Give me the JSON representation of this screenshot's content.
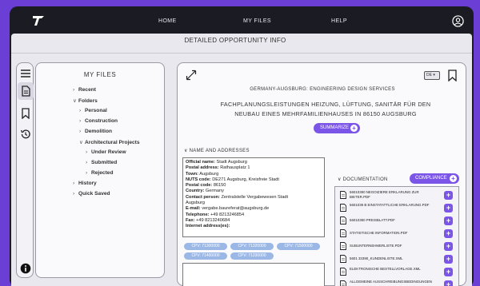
{
  "nav": {
    "home": "HOME",
    "my_files": "MY FILES",
    "help": "HELP"
  },
  "page_title": "DETAILED OPPORTUNITY INFO",
  "files_panel": {
    "title": "MY FILES",
    "items": [
      {
        "label": "Recent",
        "caret": "›"
      },
      {
        "label": "Folders",
        "caret": "∨"
      },
      {
        "label": "Personal",
        "caret": "›"
      },
      {
        "label": "Construction",
        "caret": "›"
      },
      {
        "label": "Demolition",
        "caret": "›"
      },
      {
        "label": "Architectural Projects",
        "caret": "∨"
      },
      {
        "label": "Under Review",
        "caret": "›"
      },
      {
        "label": "Submitted",
        "caret": "›"
      },
      {
        "label": "Rejected",
        "caret": "›"
      },
      {
        "label": "History",
        "caret": "›"
      },
      {
        "label": "Quick Saved",
        "caret": "›"
      }
    ]
  },
  "main": {
    "language": "DE",
    "subtitle": "GERMANY-AUGSBURG: ENGINEERING DESIGN SERVICES",
    "heading_line1": "FACHPLANUNGSLEISTUNGEN HEIZUNG, LÜFTUNG, SANITÄR FÜR DEN",
    "heading_line2": "NEUBAU EINES MEHRFAMILIENHAUSES IN 86150 AUGSBURG",
    "summarize_label": "SUMMARIZE",
    "name_address_label": "NAME AND ADDRESSES",
    "address_lines": [
      {
        "key": "Official name:",
        "value": " Stadt Augsburg"
      },
      {
        "key": "Postal address:",
        "value": " Rathausplatz 1"
      },
      {
        "key": "Town:",
        "value": " Augsburg"
      },
      {
        "key": "NUTS code:",
        "value": " DE271 Augsburg, Kreisfreie Stadt"
      },
      {
        "key": "Postal code:",
        "value": " 86150"
      },
      {
        "key": "Country:",
        "value": " Germany"
      },
      {
        "key": "Contact person:",
        "value": " Zentralstelle Vergabewesen Stadt"
      },
      {
        "key": "",
        "value": "Augsburg"
      },
      {
        "key": "E-mail:",
        "value": " vergabe.baureferat@augsburg.de"
      },
      {
        "key": "Telephone:",
        "value": " +49 8213246854"
      },
      {
        "key": "Fax:",
        "value": " +49 8213240684"
      },
      {
        "key": "Internet address(es):",
        "value": ""
      }
    ],
    "cpv_chips": [
      "CPV: 71300000",
      "CPV: 71320000",
      "CPV: 71500000",
      "CPV: 71400000",
      "CPV: 71330000"
    ],
    "documentation_label": "DOCUMENTATION",
    "compliance_label": "COMPLIANCE",
    "documents": [
      "56010390 NEGOIZIERE ERKLARUNG ZUR BIETER.PDF",
      "5601039 B EINSTATATTLICHE ERKLARUNG.PDF",
      "56010390 PREISBLATT.PDF",
      "STATISTISCHE INFORMATION.PDF",
      "SUBUNTERNEHMERLISTE.PDF",
      "5601 33390_KUNDENLISTE.XML",
      "ELEKTRONISCHE BESTELLVORLAGE.XML",
      "ALLGEMEINE AUSSCHREIBUNGSBEDINGUNGEN"
    ]
  }
}
